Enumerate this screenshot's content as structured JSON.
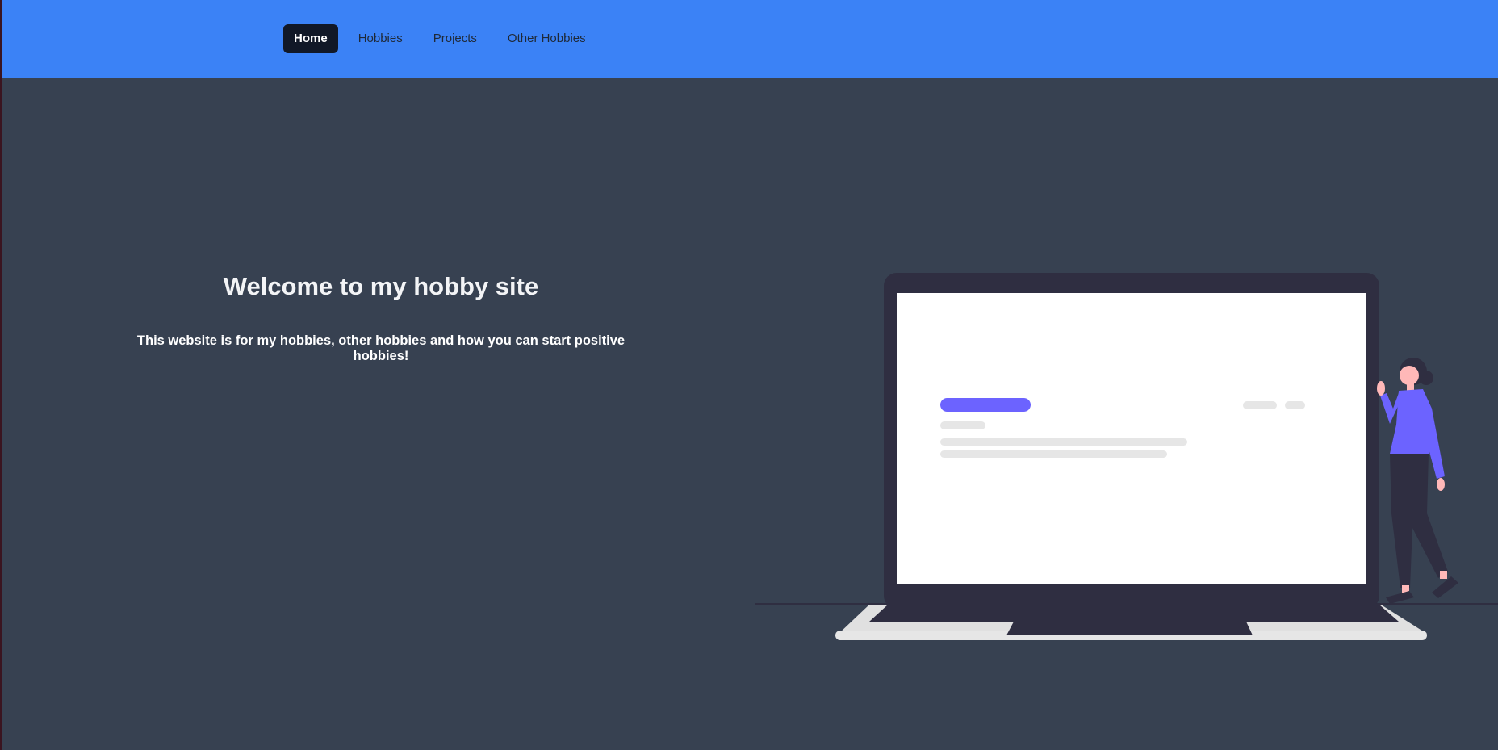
{
  "nav": {
    "items": [
      {
        "label": "Home",
        "active": true
      },
      {
        "label": "Hobbies",
        "active": false
      },
      {
        "label": "Projects",
        "active": false
      },
      {
        "label": "Other Hobbies",
        "active": false
      }
    ]
  },
  "hero": {
    "title": "Welcome to my hobby site",
    "subtitle": "This website is for my hobbies, other hobbies and how you can start positive hobbies!"
  },
  "illustration": {
    "icon": "person-with-laptop-illustration",
    "colors": {
      "accent": "#6c63ff",
      "dark": "#2f2e41",
      "skin": "#ffb8b8",
      "placeholder": "#e6e6e6"
    }
  },
  "colors": {
    "navbar": "#3b82f6",
    "background": "#374151",
    "active_nav": "#111827"
  }
}
